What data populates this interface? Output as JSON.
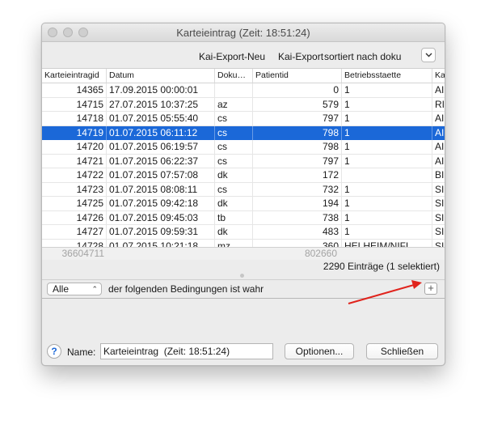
{
  "window": {
    "title": "Karteieintrag  (Zeit: 18:51:24)"
  },
  "toolbar": {
    "items": [
      "Kai-Export-Neu",
      "Kai-Export",
      "sortiert nach doku"
    ],
    "dropdown_icon": "chevron-down-icon"
  },
  "table": {
    "columns": [
      "Karteieintragid",
      "Datum",
      "Doku…",
      "Patientid",
      "Betriebsstaette",
      "Ka"
    ],
    "rows": [
      [
        "14365",
        "17.09.2015 00:00:01",
        "",
        "0",
        "1",
        "AI"
      ],
      [
        "14715",
        "27.07.2015 10:37:25",
        "az",
        "579",
        "1",
        "RI"
      ],
      [
        "14718",
        "01.07.2015 05:55:40",
        "cs",
        "797",
        "1",
        "AI"
      ],
      [
        "14719",
        "01.07.2015 06:11:12",
        "cs",
        "798",
        "1",
        "AI"
      ],
      [
        "14720",
        "01.07.2015 06:19:57",
        "cs",
        "798",
        "1",
        "AI"
      ],
      [
        "14721",
        "01.07.2015 06:22:37",
        "cs",
        "797",
        "1",
        "AI"
      ],
      [
        "14722",
        "01.07.2015 07:57:08",
        "dk",
        "172",
        "",
        "BI"
      ],
      [
        "14723",
        "01.07.2015 08:08:11",
        "cs",
        "732",
        "1",
        "SI"
      ],
      [
        "14725",
        "01.07.2015 09:42:18",
        "dk",
        "194",
        "1",
        "SI"
      ],
      [
        "14726",
        "01.07.2015 09:45:03",
        "tb",
        "738",
        "1",
        "SI"
      ],
      [
        "14727",
        "01.07.2015 09:59:31",
        "dk",
        "483",
        "1",
        "SI"
      ],
      [
        "14728",
        "01.07.2015 10:21:18",
        "mz",
        "360",
        "HELHEIM/NIFL…",
        "SI"
      ]
    ],
    "selected_row": 3,
    "sums": {
      "id": "36604711",
      "patientid": "802660"
    },
    "count": "2290 Einträge (1 selektiert)"
  },
  "rule": {
    "select_value": "Alle",
    "text": "der folgenden Bedingungen ist wahr",
    "add_label": "+"
  },
  "footer": {
    "help_label": "?",
    "name_label": "Name:",
    "name_value": "Karteieintrag  (Zeit: 18:51:24)",
    "options_label": "Optionen...",
    "close_label": "Schließen"
  },
  "colors": {
    "selection": "#1b68d8",
    "annotation_arrow": "#e0231c"
  }
}
